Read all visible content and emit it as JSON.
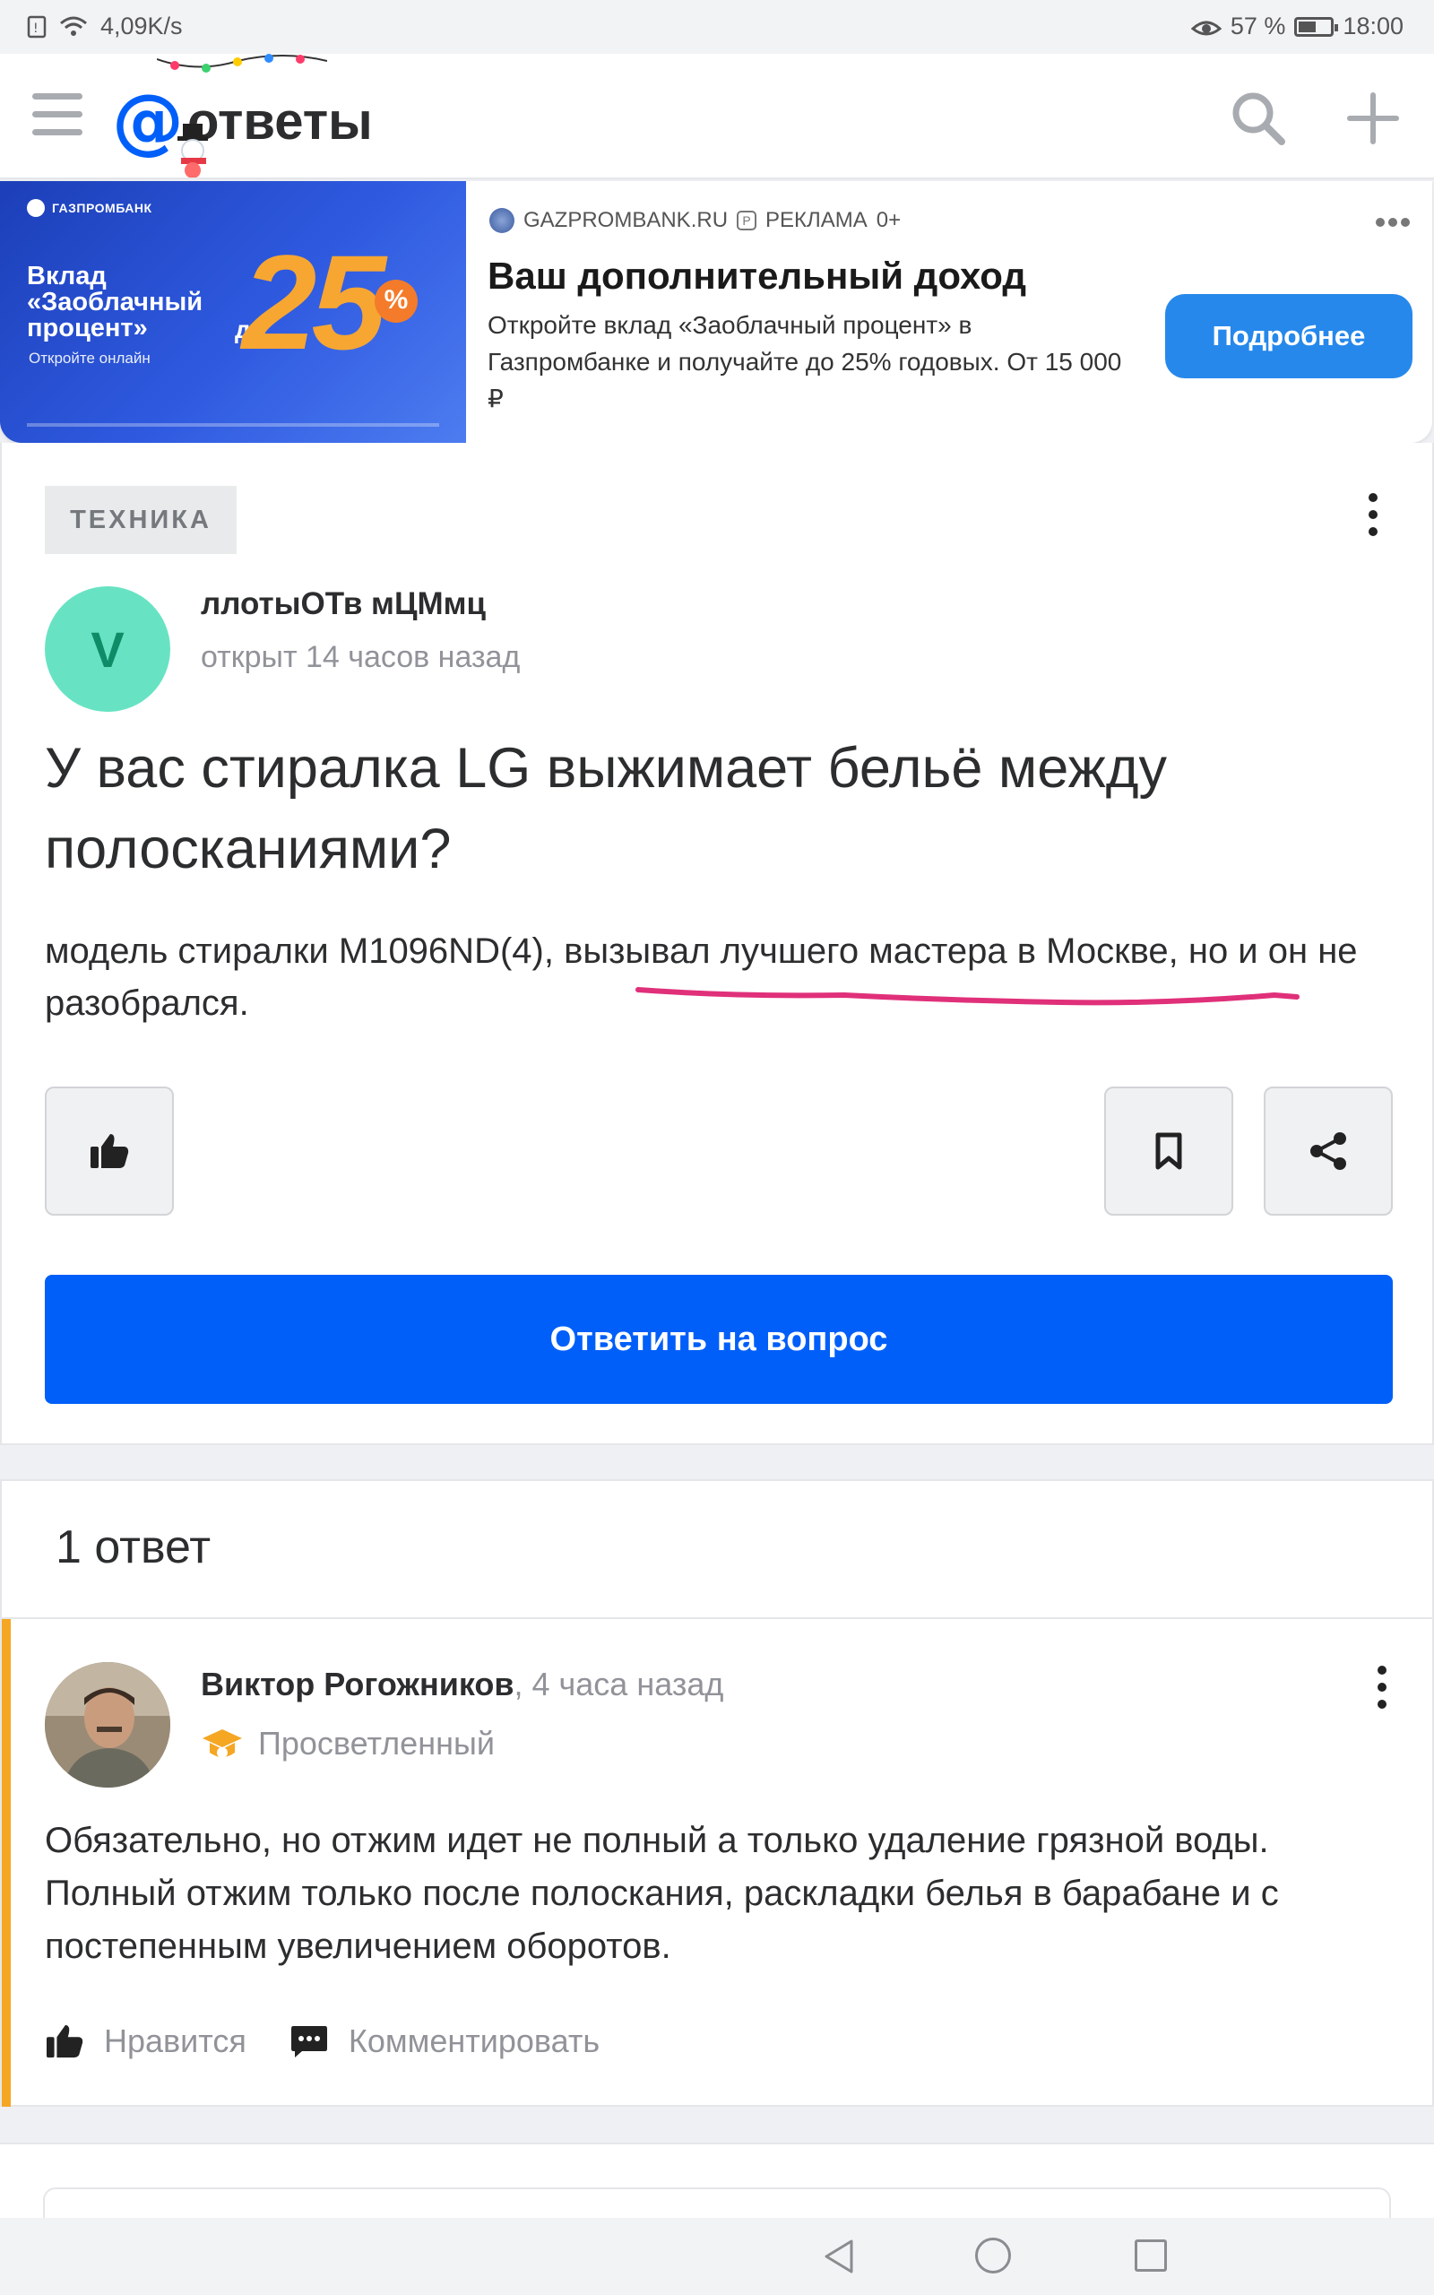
{
  "status_bar": {
    "speed": "4,09K/s",
    "battery": "57 %",
    "battery_level": 0.57,
    "time": "18:00"
  },
  "header": {
    "logo_at": "@",
    "logo_text": "ответы"
  },
  "ad": {
    "banner": {
      "bank": "ГАЗПРОМБАНК",
      "slogan": "Вклад «Заоблачный процент»",
      "online": "Откройте онлайн",
      "prefix": "до",
      "percent": "25",
      "percent_sign": "%"
    },
    "source": "GAZPROMBANK.RU",
    "label": "РЕКЛАМА",
    "age": "0+",
    "title": "Ваш дополнительный доход",
    "description": "Откройте вклад «Заоблачный процент» в Газпромбанке и получайте до 25% годовых. От 15 000 ₽",
    "button": "Подробнее"
  },
  "question": {
    "category": "ТЕХНИКА",
    "avatar_letter": "V",
    "author": "ллотыОТв мЦМмц",
    "time": "открыт 14 часов назад",
    "title": "У вас стиралка LG выжимает бельё между полосканиями?",
    "body": "модель стиралки  M1096ND(4), вызывал лучшего мастера в Москве, но и он не разобрался.",
    "answer_button": "Ответить на вопрос"
  },
  "answers": {
    "count_label": "1 ответ",
    "items": [
      {
        "author": "Виктор Рогожников",
        "time": ", 4 часа назад",
        "rank": "Просветленный",
        "text": "Обязательно, но отжим идет не полный а только удаление грязной воды. Полный отжим только после полоскания, раскладки белья в барабане и с постепенным увеличением оборотов.",
        "like_label": "Нравится",
        "comment_label": "Комментировать"
      }
    ]
  },
  "colors": {
    "brand_blue": "#005ff9",
    "ad_button": "#2688eb",
    "answer_accent": "#f5a623",
    "avatar_bg": "#67e3c3",
    "underline": "#e0307a"
  }
}
